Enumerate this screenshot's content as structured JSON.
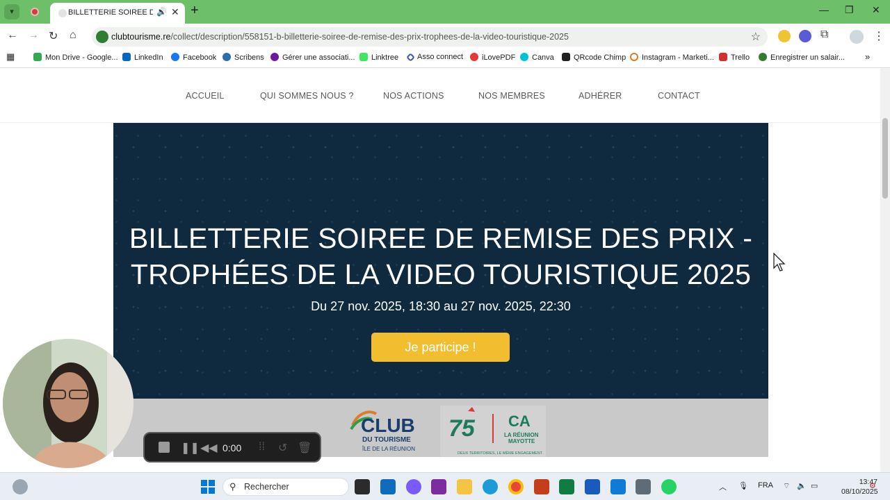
{
  "browser": {
    "tab_title": "BILLETTERIE SOIREE DE REMISE",
    "url_host": "clubtourisme.re",
    "url_path": "/collect/description/558151-b-billetterie-soiree-de-remise-des-prix-trophees-de-la-video-touristique-2025",
    "bookmarks": [
      "Mon Drive - Google...",
      "LinkedIn",
      "Facebook",
      "Scribens",
      "Gérer une associati...",
      "Linktree",
      "Asso connect",
      "iLovePDF",
      "Canva",
      "QRcode Chimp",
      "Instagram - Marketi...",
      "Trello",
      "Enregistrer un salair..."
    ]
  },
  "site_nav": {
    "items": [
      "ACCUEIL",
      "QUI SOMMES NOUS ?",
      "NOS ACTIONS",
      "NOS MEMBRES",
      "ADHÉRER",
      "CONTACT"
    ]
  },
  "hero": {
    "title_line1": "BILLETTERIE SOIREE DE REMISE DES PRIX -",
    "title_line2": "TROPHÉES DE LA VIDEO TOURISTIQUE 2025",
    "date": "Du 27 nov. 2025, 18:30 au 27 nov. 2025, 22:30",
    "cta": "Je participe !"
  },
  "logos": {
    "club_name": "CLUB",
    "club_sub1": "DU TOURISME",
    "club_sub2": "ÎLE DE LA RÉUNION",
    "ca_75": "75",
    "ca_ca": "CA",
    "ca_line1": "LA RÉUNION",
    "ca_line2": "MAYOTTE",
    "ca_tagline": "DEUX TERRITOIRES, LE MÊME ENGAGEMENT"
  },
  "recorder": {
    "time": "0:00"
  },
  "taskbar": {
    "search": "Rechercher",
    "lang": "FRA",
    "time": "13:47",
    "date": "08/10/2025"
  },
  "colors": {
    "tabbar": "#6dbf6a",
    "hero_bg": "#0f2a3f",
    "cta": "#f2be2f"
  }
}
